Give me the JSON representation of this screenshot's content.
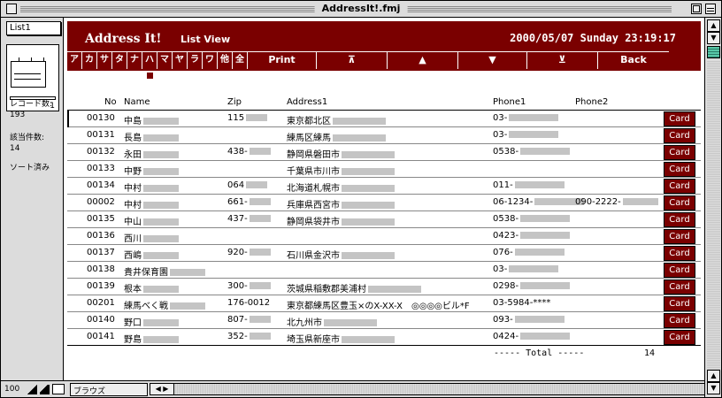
{
  "window": {
    "title": "AddressIt!.fmj"
  },
  "status_area": {
    "layout": "List1",
    "page_number": "1",
    "record_label": "レコード数:",
    "record_count": "193",
    "found_label": "該当件数:",
    "found_count": "14",
    "sort_status": "ソート済み"
  },
  "bottom_bar": {
    "zoom": "100",
    "mode": "ブラウズ"
  },
  "header": {
    "app_title": "Address It!",
    "view_name": "List View",
    "datetime": "2000/05/07 Sunday  23:19:17",
    "kana_buttons": [
      "ア",
      "カ",
      "サ",
      "タ",
      "ナ",
      "ハ",
      "マ",
      "ヤ",
      "ラ",
      "ワ",
      "他",
      "全"
    ],
    "print_label": "Print",
    "back_label": "Back"
  },
  "columns": {
    "no": "No",
    "name": "Name",
    "zip": "Zip",
    "address": "Address1",
    "phone1": "Phone1",
    "phone2": "Phone2"
  },
  "card_label": "Card",
  "rows": [
    {
      "no": "00130",
      "name": "中島",
      "zip": "115",
      "address": "東京都北区",
      "phone1": "03-",
      "phone2": ""
    },
    {
      "no": "00131",
      "name": "長島",
      "zip": "",
      "address": "練馬区練馬",
      "phone1": "03-",
      "phone2": ""
    },
    {
      "no": "00132",
      "name": "永田",
      "zip": "438-",
      "address": "静岡県磐田市",
      "phone1": "0538-",
      "phone2": ""
    },
    {
      "no": "00133",
      "name": "中野",
      "zip": "",
      "address": "千葉県市川市",
      "phone1": "",
      "phone2": ""
    },
    {
      "no": "00134",
      "name": "中村",
      "zip": "064",
      "address": "北海道札幌市",
      "phone1": "011-",
      "phone2": ""
    },
    {
      "no": "00002",
      "name": "中村",
      "zip": "661-",
      "address": "兵庫県西宮市",
      "phone1": "06-1234-",
      "phone2": "090-2222-"
    },
    {
      "no": "00135",
      "name": "中山",
      "zip": "437-",
      "address": "静岡県袋井市",
      "phone1": "0538-",
      "phone2": ""
    },
    {
      "no": "00136",
      "name": "西川",
      "zip": "",
      "address": "",
      "phone1": "0423-",
      "phone2": ""
    },
    {
      "no": "00137",
      "name": "西嶋",
      "zip": "920-",
      "address": "石川県金沢市",
      "phone1": "076-",
      "phone2": ""
    },
    {
      "no": "00138",
      "name": "貴井保育園",
      "zip": "",
      "address": "",
      "phone1": "03-",
      "phone2": ""
    },
    {
      "no": "00139",
      "name": "根本",
      "zip": "300-",
      "address": "茨城県稲敷郡美浦村",
      "phone1": "0298-",
      "phone2": ""
    },
    {
      "no": "00201",
      "name": "練馬べく戦",
      "zip": "176-0012",
      "address": "東京都練馬区豊玉×のX-XX-X　◎◎◎◎ビル*F",
      "phone1": "03-5984-****",
      "phone2": ""
    },
    {
      "no": "00140",
      "name": "野口",
      "zip": "807-",
      "address": "北九州市",
      "phone1": "093-",
      "phone2": ""
    },
    {
      "no": "00141",
      "name": "野島",
      "zip": "352-",
      "address": "埼玉県新座市",
      "phone1": "0424-",
      "phone2": ""
    }
  ],
  "footer": {
    "total_text": "-----  Total  -----",
    "total_value": "14"
  },
  "colors": {
    "brand": "#7a0000",
    "scroll_thumb": "#58c8a8"
  }
}
